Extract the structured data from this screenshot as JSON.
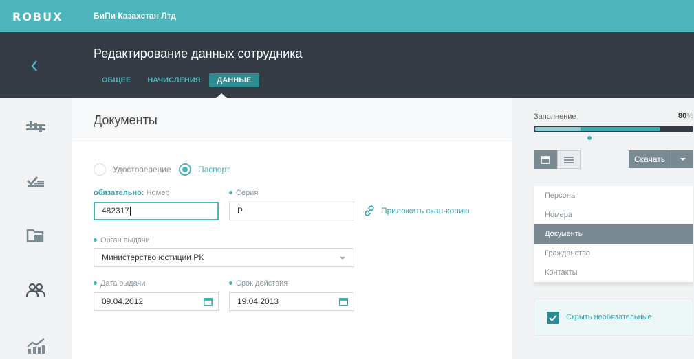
{
  "app": {
    "logo": "ROBUX",
    "company": "БиПи Казахстан Лтд"
  },
  "header": {
    "title": "Редактирование данных сотрудника",
    "tabs": [
      {
        "label": "ОБЩЕЕ",
        "active": false
      },
      {
        "label": "НАЧИСЛЕНИЯ",
        "active": false
      },
      {
        "label": "ДАННЫЕ",
        "active": true
      }
    ]
  },
  "nav": {
    "icons": [
      "sliders-icon",
      "checklist-icon",
      "folder-icon",
      "people-icon",
      "analytics-icon"
    ]
  },
  "main": {
    "section_title": "Документы",
    "doc_type": {
      "options": [
        {
          "label": "Удостоверение",
          "selected": false
        },
        {
          "label": "Паспорт",
          "selected": true
        }
      ]
    },
    "number": {
      "required_label": "обязательно:",
      "label": "Номер",
      "value": "482317"
    },
    "series": {
      "label": "Серия",
      "value": "Р"
    },
    "attach_label": "Приложить скан-копию",
    "issuer": {
      "label": "Орган выдачи",
      "value": "Министерство юстиции РК"
    },
    "issue_date": {
      "label": "Дата выдачи",
      "value": "09.04.2012"
    },
    "expiry_date": {
      "label": "Срок действия",
      "value": "19.04.2013"
    }
  },
  "sidebar": {
    "fill_label": "Заполнение",
    "fill_value": "80",
    "fill_unit": "%",
    "fill_progress": 0.8,
    "download_label": "Скачать",
    "sections": [
      {
        "label": "Персона",
        "active": false
      },
      {
        "label": "Номера",
        "active": false
      },
      {
        "label": "Документы",
        "active": true
      },
      {
        "label": "Гражданство",
        "active": false
      },
      {
        "label": "Контакты",
        "active": false
      }
    ],
    "hide_optional_label": "Скрыть необязательные",
    "hide_optional_checked": true
  },
  "colors": {
    "accent": "#4cb4bb",
    "accent_dark": "#2c8c92",
    "header": "#353b44",
    "muted": "#7a8a93"
  }
}
